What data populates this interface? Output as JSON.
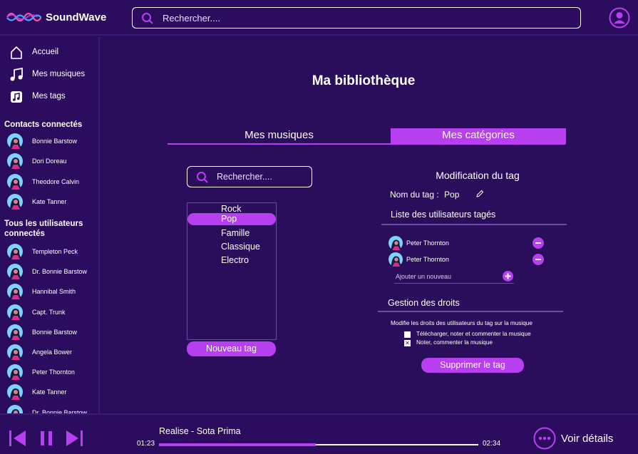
{
  "app": {
    "name": "SoundWave"
  },
  "header": {
    "search_placeholder": "Rechercher...."
  },
  "sidebar": {
    "nav": [
      {
        "label": "Accueil",
        "icon": "home-icon"
      },
      {
        "label": "Mes musiques",
        "icon": "music-note-icon"
      },
      {
        "label": "Mes tags",
        "icon": "tag-music-icon"
      }
    ],
    "connected_contacts_title": "Contacts connectés",
    "connected_contacts": [
      "Bonnie Barstow",
      "Dori Doreau",
      "Theodore Calvin",
      "Kate Tanner"
    ],
    "all_users_title": "Tous les utilisateurs connectés",
    "all_users": [
      "Templeton Peck",
      "Dr. Bonnie Barstow",
      "Hannibal Smith",
      "Capt. Trunk",
      "Bonnie Barstow",
      "Angela Bower",
      "Peter Thornton",
      "Kate Tanner",
      "Dr. Bonnie Barstow"
    ]
  },
  "main": {
    "title": "Ma bibliothèque",
    "tabs": [
      {
        "label": "Mes musiques",
        "active": false
      },
      {
        "label": "Mes catégories",
        "active": true
      }
    ],
    "search_placeholder": "Rechercher....",
    "tags": [
      "Rock",
      "Pop",
      "Famille",
      "Classique",
      "Electro"
    ],
    "selected_tag": "Pop",
    "new_tag_button": "Nouveau tag",
    "edit": {
      "title": "Modification du tag",
      "name_label": "Nom du tag :",
      "name_value": "Pop",
      "users_title": "Liste des utilisateurs tagés",
      "users": [
        "Peter Thornton",
        "Peter Thornton"
      ],
      "add_placeholder": "Ajouter un nouveau",
      "rights_title": "Gestion des droits",
      "rights_desc": "Modifie les droits des utilisateurs du tag sur la musique",
      "rights": [
        {
          "label": "Télécharger, noter et commenter la musique",
          "checked": false
        },
        {
          "label": "Noter, commenter la musique",
          "checked": true
        }
      ],
      "delete_button": "Supprimer le tag"
    }
  },
  "player": {
    "track": "Realise - Sota Prima",
    "elapsed": "01:23",
    "duration": "02:34",
    "progress": 0.49,
    "details_label": "Voir détails"
  },
  "colors": {
    "background": "#2a0e5c",
    "panel": "#2b0c5f",
    "accent": "#b73ff0",
    "divider": "#6e4aa8"
  }
}
